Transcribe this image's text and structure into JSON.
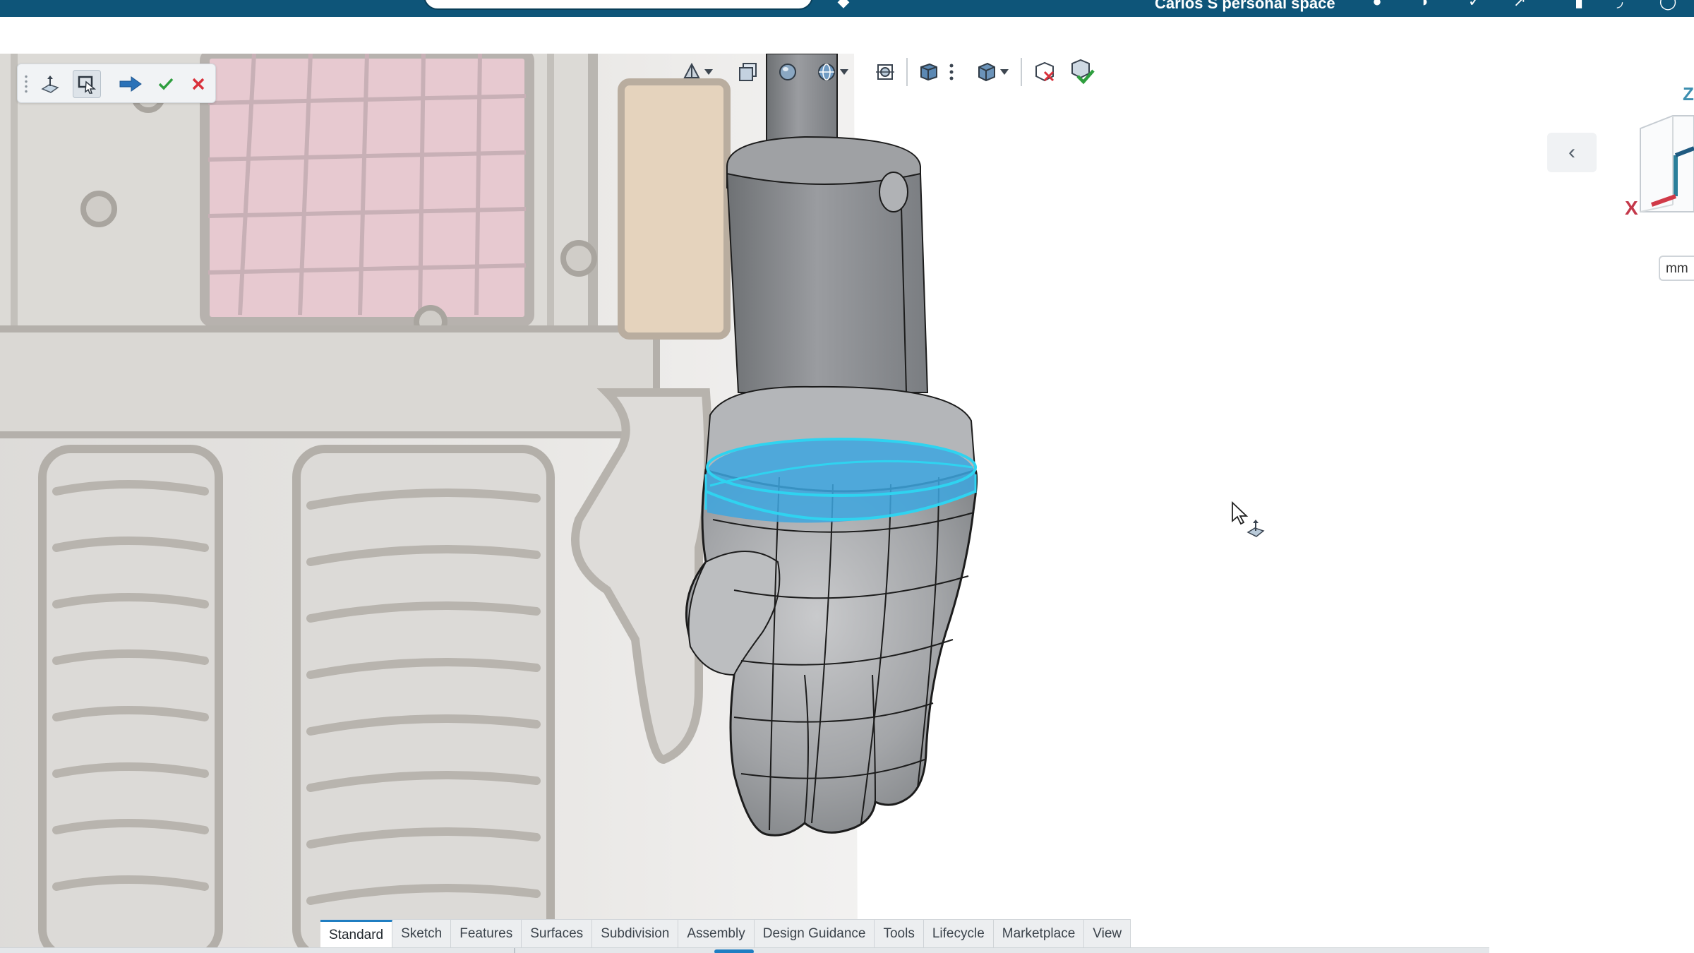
{
  "topbar": {
    "workspace_label": "Carlos S personal space"
  },
  "feature_toolbar": {
    "tools": [
      "plane-sketch-icon",
      "select-icon",
      "next-arrow-icon",
      "confirm-check-icon",
      "cancel-x-icon"
    ]
  },
  "view_toolbar": {
    "tools": [
      "view-orientation-icon",
      "section-view-icon",
      "render-mode-icon",
      "display-style-icon",
      "zoom-fit-icon",
      "named-views-icon",
      "more-options-icon",
      "cube-view-icon",
      "hide-selected-icon",
      "show-all-icon"
    ]
  },
  "right_panel": {
    "collapse_glyph": "‹",
    "axis_z": "Z",
    "axis_x": "X",
    "units": "mm"
  },
  "tabs": {
    "items": [
      "Standard",
      "Sketch",
      "Features",
      "Surfaces",
      "Subdivision",
      "Assembly",
      "Design Guidance",
      "Tools",
      "Lifecycle",
      "Marketplace",
      "View"
    ],
    "active": "Standard"
  },
  "colors": {
    "topbar": "#0e5579",
    "selection_highlight": "#2fb8e6",
    "model_gray": "#8c8e92",
    "accent_blue": "#1f7ec2",
    "confirm_green": "#2e9e3e",
    "cancel_red": "#d9303a"
  }
}
